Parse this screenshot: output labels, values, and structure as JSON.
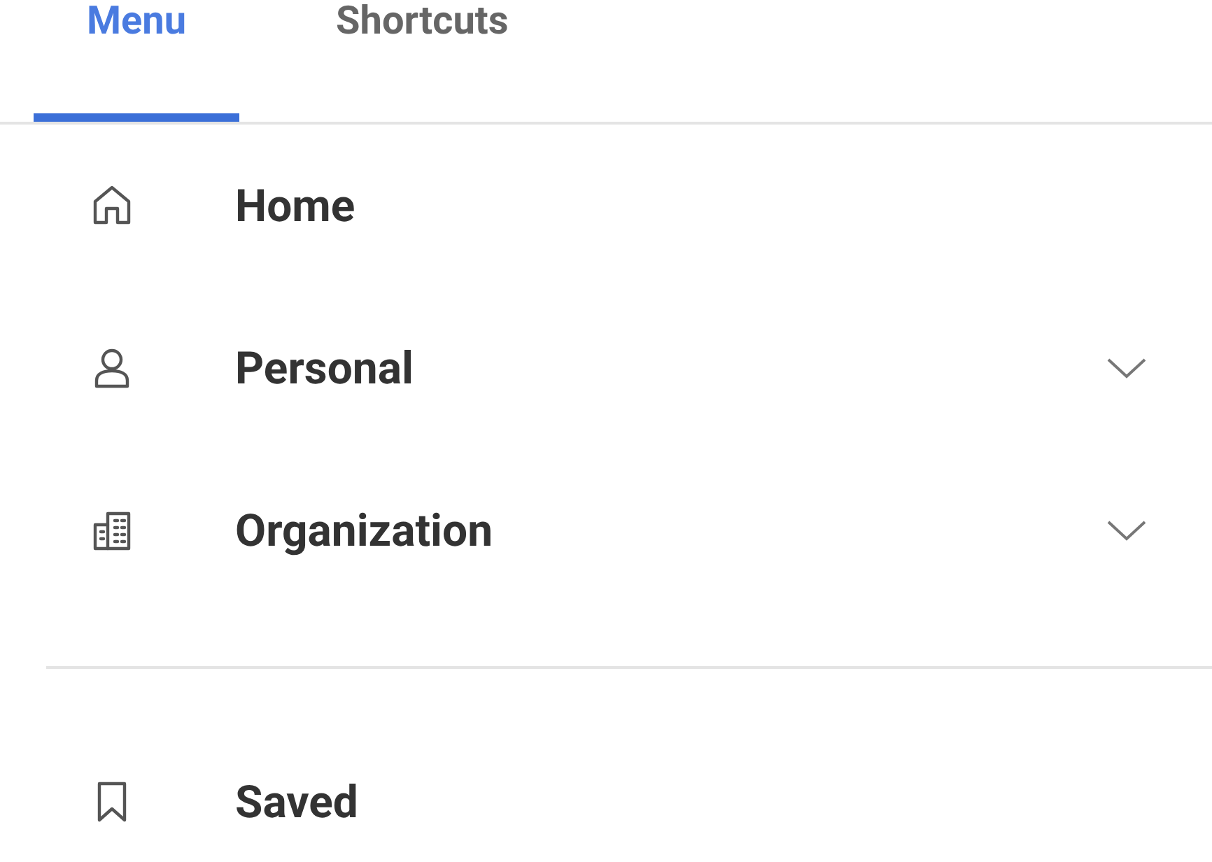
{
  "tabs": [
    {
      "label": "Menu",
      "selected": true
    },
    {
      "label": "Shortcuts",
      "selected": false
    }
  ],
  "menu_items": [
    {
      "label": "Home",
      "expandable": false
    },
    {
      "label": "Personal",
      "expandable": true
    },
    {
      "label": "Organization",
      "expandable": true
    }
  ],
  "saved_items": [
    {
      "label": "Saved",
      "expandable": false
    }
  ]
}
